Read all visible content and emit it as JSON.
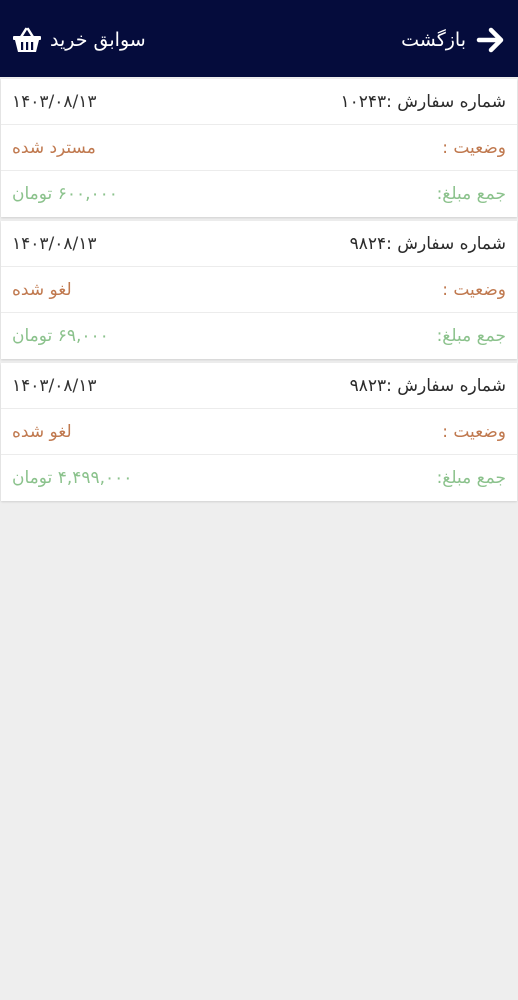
{
  "header": {
    "back_label": "بازگشت",
    "history_label": "سوابق خرید",
    "background_color": "#050c3c",
    "back_icon": "arrow-right-icon",
    "history_icon": "shopping-basket-icon"
  },
  "colors": {
    "status": "#c0794f",
    "amount": "#8bc28c"
  },
  "orders": [
    {
      "date": "۱۴۰۳/۰۸/۱۳",
      "order_label": "شماره سفارش :۱۰۲۴۳",
      "status_label": "وضعیت :",
      "status_value": "مسترد شده",
      "amount_label": "جمع مبلغ:",
      "amount_value": "۶۰۰,۰۰۰ تومان"
    },
    {
      "date": "۱۴۰۳/۰۸/۱۳",
      "order_label": "شماره سفارش :۹۸۲۴",
      "status_label": "وضعیت :",
      "status_value": "لغو شده",
      "amount_label": "جمع مبلغ:",
      "amount_value": "۶۹,۰۰۰ تومان"
    },
    {
      "date": "۱۴۰۳/۰۸/۱۳",
      "order_label": "شماره سفارش :۹۸۲۳",
      "status_label": "وضعیت :",
      "status_value": "لغو شده",
      "amount_label": "جمع مبلغ:",
      "amount_value": "۴,۴۹۹,۰۰۰ تومان"
    }
  ]
}
